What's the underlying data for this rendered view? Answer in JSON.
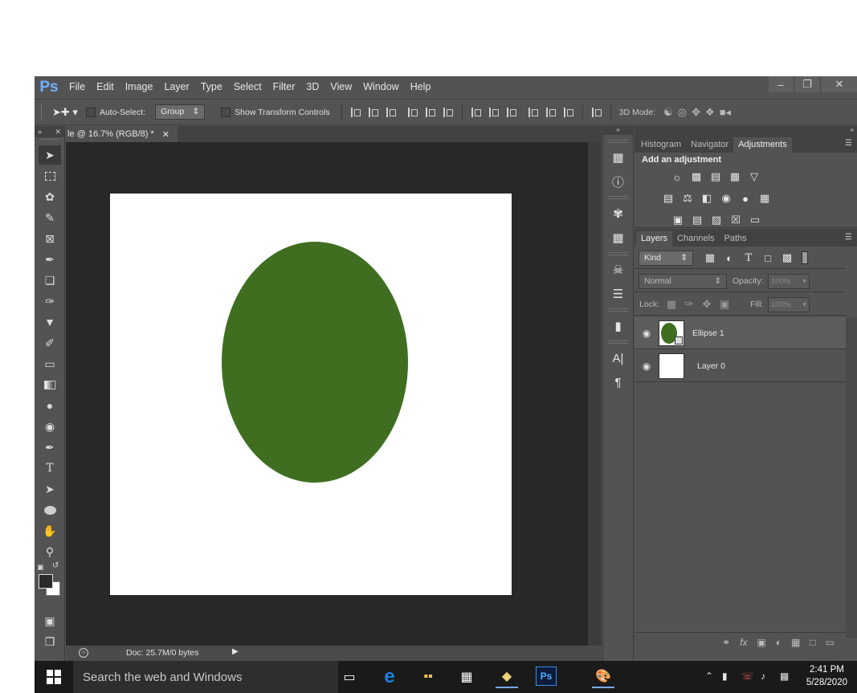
{
  "app": {
    "logo": "Ps"
  },
  "menu": [
    "File",
    "Edit",
    "Image",
    "Layer",
    "Type",
    "Select",
    "Filter",
    "3D",
    "View",
    "Window",
    "Help"
  ],
  "options": {
    "auto_select_label": "Auto-Select:",
    "auto_select_value": "Group",
    "show_transform_label": "Show Transform Controls",
    "mode_3d_label": "3D Mode:"
  },
  "document": {
    "tab_title": "le @ 16.7% (RGB/8) *",
    "status": "Doc: 25.7M/0 bytes",
    "ellipse_color": "#3f6e21"
  },
  "panels": {
    "top_tabs": [
      "Histogram",
      "Navigator",
      "Adjustments"
    ],
    "active_top_tab": "Adjustments",
    "adjustments_title": "Add an adjustment",
    "layer_tabs": [
      "Layers",
      "Channels",
      "Paths"
    ],
    "filter_kind": "Kind",
    "blend_mode": "Normal",
    "opacity_label": "Opacity:",
    "opacity_value": "100%",
    "lock_label": "Lock:",
    "fill_label": "Fill:",
    "fill_value": "100%",
    "layers": [
      {
        "name": "Ellipse 1",
        "type": "shape"
      },
      {
        "name": "Layer 0",
        "type": "raster"
      }
    ]
  },
  "taskbar": {
    "search_placeholder": "Search the web and Windows",
    "time": "2:41 PM",
    "date": "5/28/2020"
  }
}
